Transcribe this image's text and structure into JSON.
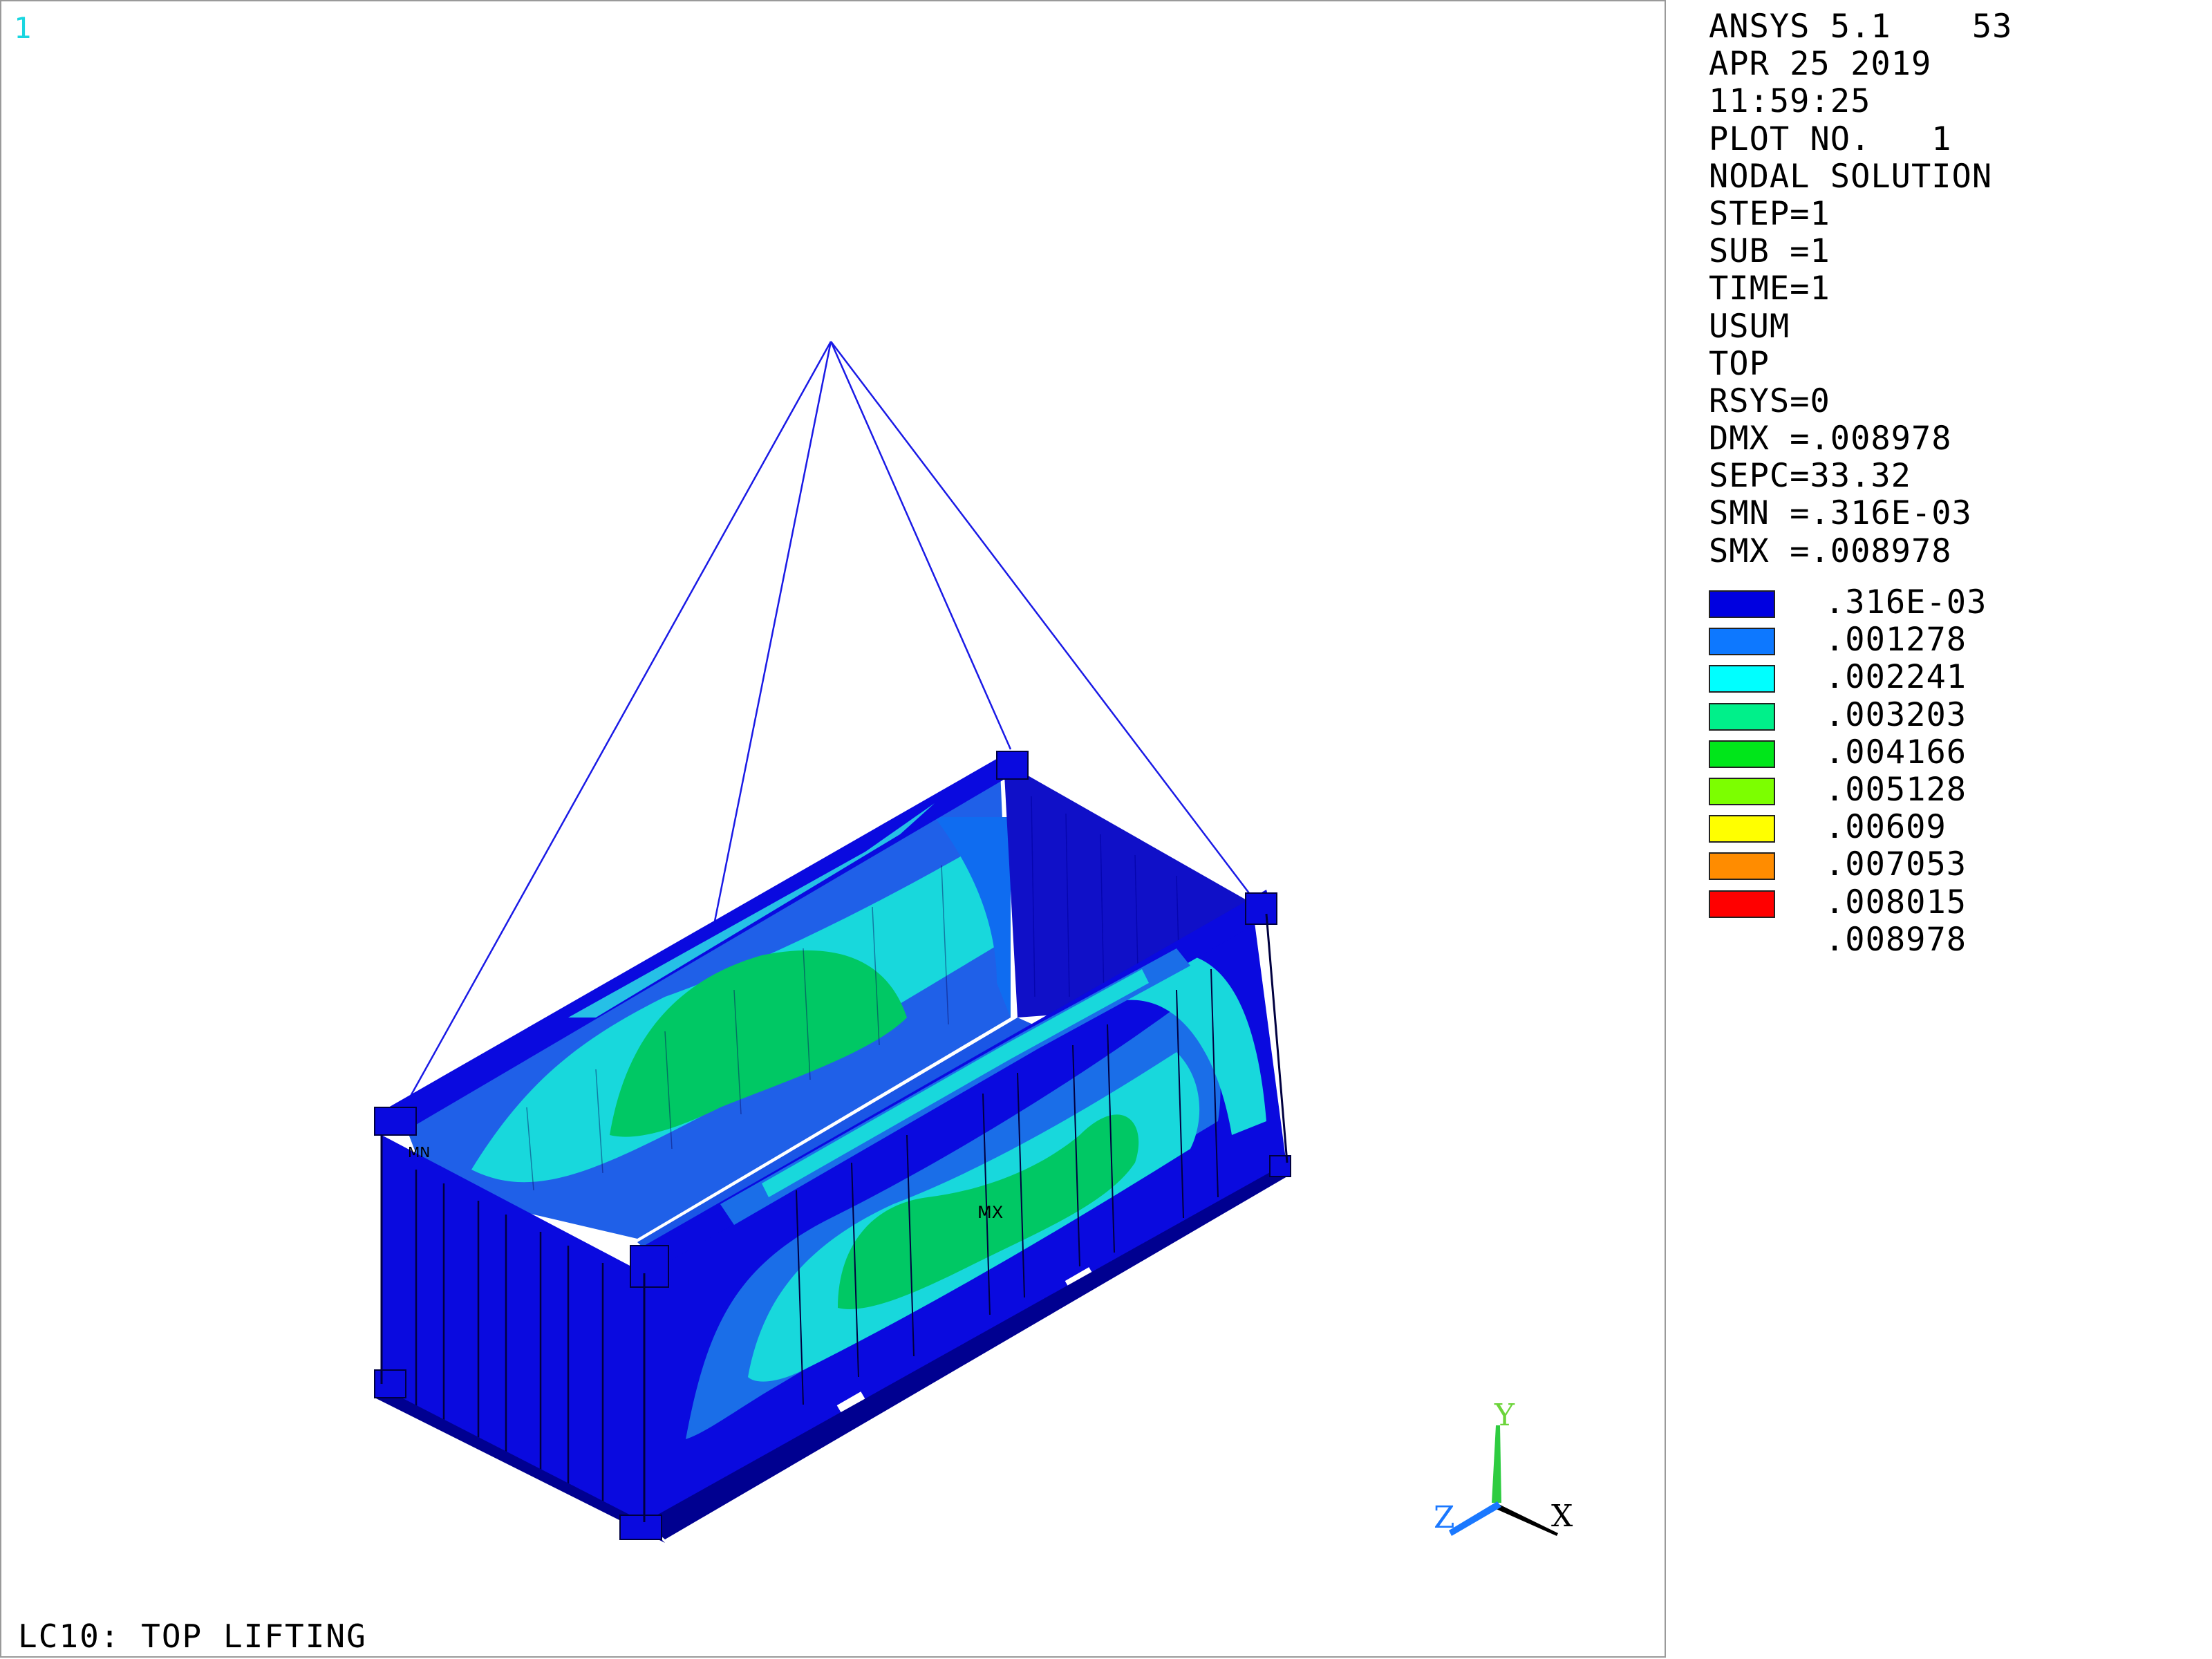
{
  "window_number": "1",
  "load_case_title": "LC10: TOP LIFTING",
  "info_lines": [
    "ANSYS 5.1    53",
    "APR 25 2019",
    "11:59:25",
    "PLOT NO.   1",
    "NODAL SOLUTION",
    "STEP=1",
    "SUB =1",
    "TIME=1",
    "USUM",
    "TOP",
    "RSYS=0",
    "DMX =.008978",
    "SEPC=33.32",
    "SMN =.316E-03",
    "SMX =.008978"
  ],
  "legend": {
    "levels": [
      ".316E-03",
      ".001278",
      ".002241",
      ".003203",
      ".004166",
      ".005128",
      ".00609",
      ".007053",
      ".008015",
      ".008978"
    ],
    "colors": [
      "#0000e0",
      "#0d78ff",
      "#00ffff",
      "#00f08a",
      "#00e61a",
      "#7cff00",
      "#ffff00",
      "#ff8c00",
      "#ff0000"
    ]
  },
  "markers": {
    "max_label": "MX",
    "min_label": "MN"
  },
  "triad": {
    "x_label": "X",
    "y_label": "Y",
    "z_label": "Z"
  },
  "colors": {
    "wire": "#1a1ae6",
    "frame_blue": "#0a0adf",
    "deep_blue": "#1010c8"
  }
}
